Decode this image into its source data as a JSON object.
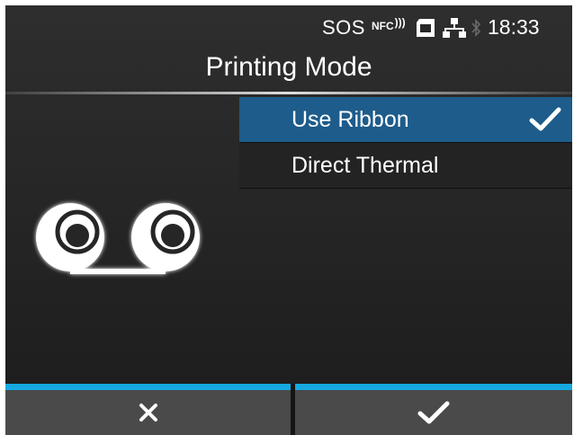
{
  "status_bar": {
    "sos_label": "SOS",
    "nfc_label": "NFC",
    "sd_icon": "sd-card-icon",
    "network_icon": "network-icon",
    "bluetooth_icon": "bluetooth-icon",
    "time": "18:33"
  },
  "header": {
    "title": "Printing Mode"
  },
  "options": [
    {
      "label": "Use Ribbon",
      "selected": true
    },
    {
      "label": "Direct Thermal",
      "selected": false
    }
  ],
  "illustration": "ribbon-icon",
  "footer": {
    "cancel_icon": "close-icon",
    "confirm_icon": "checkmark-icon",
    "accent_color": "#16a9e0"
  },
  "colors": {
    "selected_row": "#1d5c8b",
    "background": "#262626"
  }
}
